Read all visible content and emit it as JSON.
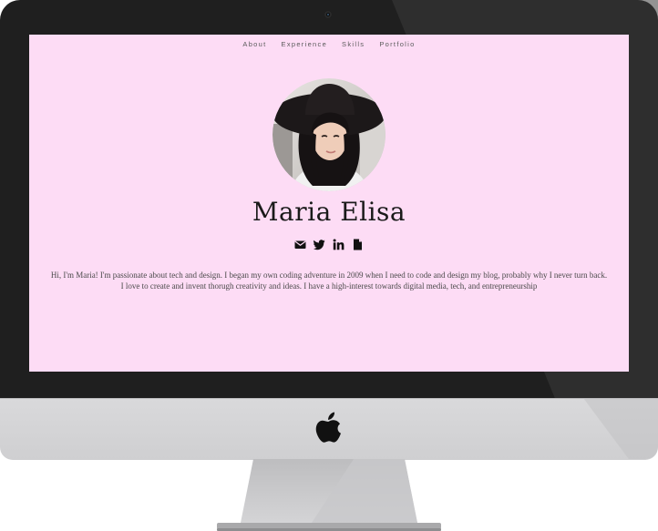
{
  "nav": {
    "items": [
      {
        "label": "About"
      },
      {
        "label": "Experience"
      },
      {
        "label": "Skills"
      },
      {
        "label": "Portfolio"
      }
    ]
  },
  "profile": {
    "name": "Maria Elisa",
    "social_icons": [
      "email-icon",
      "twitter-icon",
      "linkedin-icon",
      "resume-file-icon"
    ]
  },
  "bio": {
    "line1": "Hi, I'm Maria! I'm passionate about tech and design. I began my own coding adventure in 2009 when I need to code and design my blog, probably why I never turn back.",
    "line2": "I love to create and invent thorugh creativity and ideas. I have a high-interest towards digital media, tech, and entrepreneurship"
  },
  "colors": {
    "page_background": "#fddcf5",
    "text": "#1a1a1a",
    "bezel": "#1f1f1f"
  }
}
